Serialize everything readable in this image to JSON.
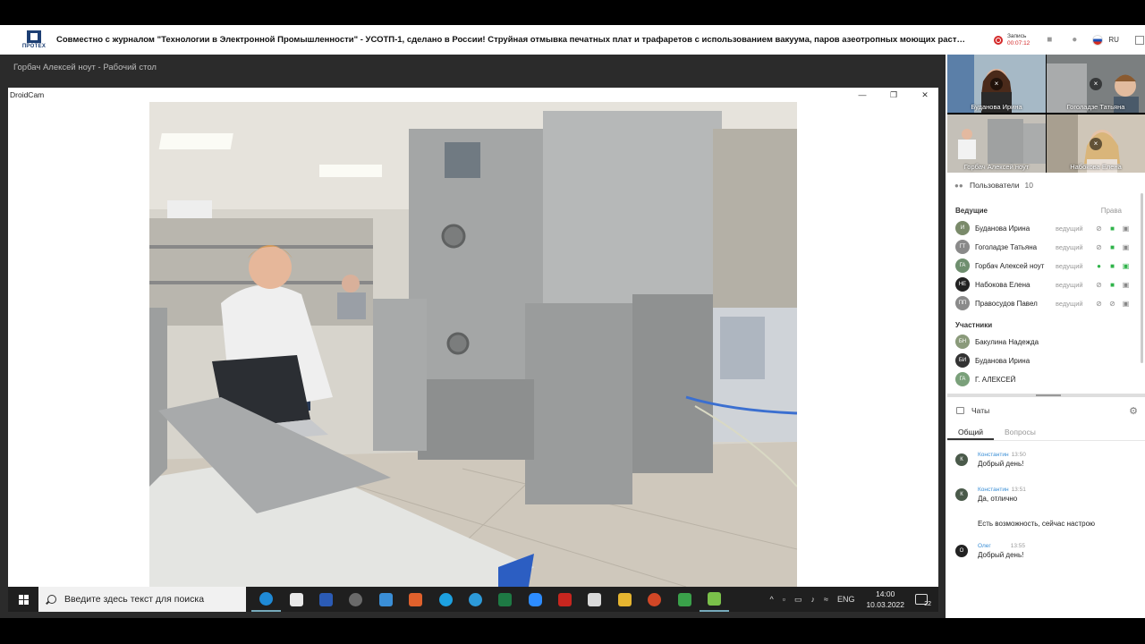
{
  "header": {
    "logo_text": "ПРОТЕХ",
    "title": "Совместно с журналом \"Технологии в Электронной Промышленности\" - УСОТП-1, сделано в России! Струйная отмывка печатных плат и трафаретов с использованием вакуума, паров азеотропных моющих растворов и дистилли...",
    "record_label": "Запись",
    "record_time": "00:07:12",
    "lang": "RU"
  },
  "share": {
    "title": "Горбач Алексей ноут - Рабочий стол",
    "window_title": "DroidCam"
  },
  "taskbar": {
    "search_placeholder": "Введите здесь текст для поиска",
    "lang": "ENG",
    "time": "14:00",
    "date": "10.03.2022",
    "notifications": "22"
  },
  "thumbnails": [
    {
      "name": "Буданова Ирина"
    },
    {
      "name": "Гоголадзе Татьяна"
    },
    {
      "name": "Горбач Алексей ноут"
    },
    {
      "name": "Набокова Елена"
    }
  ],
  "users": {
    "title": "Пользователи",
    "count": "10",
    "hosts_label": "Ведущие",
    "rights_label": "Права",
    "participants_label": "Участники",
    "hosts": [
      {
        "initials": "И",
        "name": "Буданова Ирина",
        "role": "ведущий",
        "color": "#7a8a6a"
      },
      {
        "initials": "ГТ",
        "name": "Гоголадзе Татьяна",
        "role": "ведущий",
        "color": "#8a8a8a"
      },
      {
        "initials": "ГА",
        "name": "Горбач Алексей ноут",
        "role": "ведущий",
        "color": "#6f8f6f"
      },
      {
        "initials": "НЕ",
        "name": "Набокова Елена",
        "role": "ведущий",
        "color": "#222222"
      },
      {
        "initials": "ПП",
        "name": "Правосудов Павел",
        "role": "ведущий",
        "color": "#8a8a8a"
      }
    ],
    "participants": [
      {
        "initials": "БН",
        "name": "Бакулина Надежда",
        "color": "#8a9a7a"
      },
      {
        "initials": "БИ",
        "name": "Буданова Ирина",
        "color": "#333333"
      },
      {
        "initials": "ГА",
        "name": "Г. АЛЕКСЕЙ",
        "color": "#7aa07a"
      }
    ]
  },
  "chats": {
    "title": "Чаты",
    "tab_general": "Общий",
    "tab_questions": "Вопросы",
    "messages": [
      {
        "initial": "К",
        "author": "Константин",
        "time": "13:50",
        "text": "Добрый день!"
      },
      {
        "initial": "К",
        "author": "Константин",
        "time": "13:51",
        "text": "Да, отлично"
      },
      {
        "initial": "",
        "author": "",
        "time": "",
        "text": "Есть возможность, сейчас настрою"
      },
      {
        "initial": "О",
        "author": "Олег",
        "time": "13:55",
        "text": "Добрый день!"
      }
    ]
  },
  "colors": {
    "accent_green": "#2fb34a",
    "record_red": "#d42a2a",
    "brand_blue": "#1d3f73"
  }
}
